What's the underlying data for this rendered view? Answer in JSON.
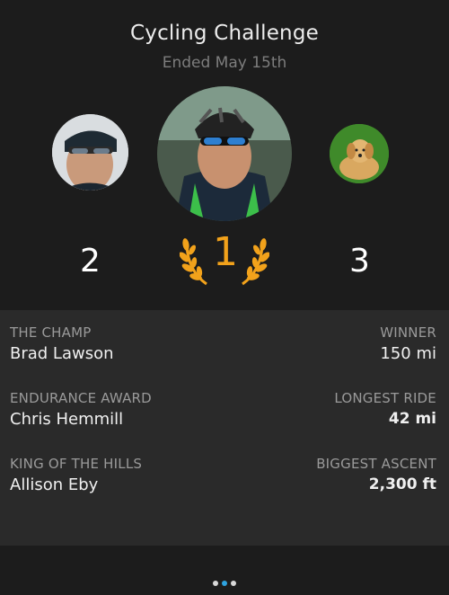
{
  "header": {
    "title": "Cycling Challenge",
    "subtitle": "Ended May 15th"
  },
  "podium": [
    {
      "rank": "2",
      "avatar": "cyclist-sunglasses-avatar"
    },
    {
      "rank": "1",
      "avatar": "cyclist-helmet-avatar"
    },
    {
      "rank": "3",
      "avatar": "dog-avatar"
    }
  ],
  "accent_color": "#f2a21b",
  "awards": [
    {
      "label": "THE CHAMP",
      "name": "Brad Lawson",
      "stat_label": "WINNER",
      "stat_value": "150 mi"
    },
    {
      "label": "ENDURANCE AWARD",
      "name": "Chris Hemmill",
      "stat_label": "LONGEST RIDE",
      "stat_value": "42 mi"
    },
    {
      "label": "KING OF THE HILLS",
      "name": "Allison Eby",
      "stat_label": "BIGGEST ASCENT",
      "stat_value": "2,300 ft"
    }
  ],
  "pager": {
    "count": 3,
    "active": 1
  }
}
